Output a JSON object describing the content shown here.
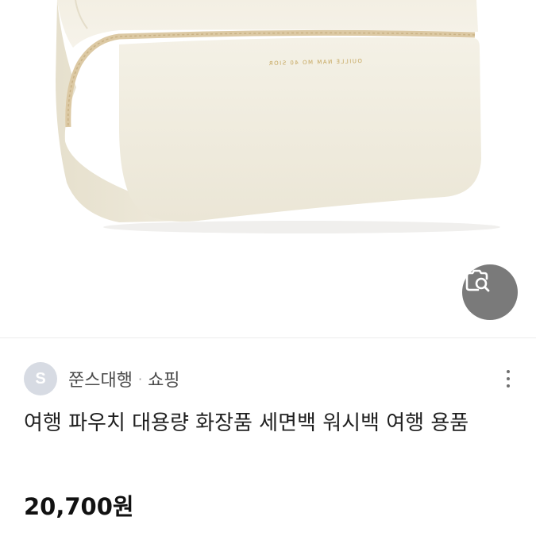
{
  "product": {
    "source_initial": "S",
    "source_name": "쭌스대행",
    "separator": "·",
    "source_category": "쇼핑",
    "title": "여행 파우치 대용량 화장품 세면백 워시백 여행 용품",
    "price": "20,700원",
    "pouch_print": "OUILLE NAM MO 40 SIOR"
  },
  "icons": {
    "lens": "visual-search-icon",
    "more": "more-vertical-icon"
  },
  "colors": {
    "pouch": "#f1ede1",
    "zipper": "#dcc9a4",
    "lens_bg": "#7a7a7a",
    "avatar_bg": "#d7dbe3"
  }
}
